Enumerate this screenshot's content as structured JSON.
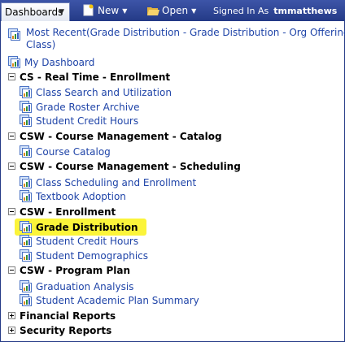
{
  "topbar": {
    "dashboards_tab": "Dashboards",
    "new_menu": "New",
    "open_menu": "Open",
    "signed_in_label": "Signed In As",
    "username": "tmmatthews"
  },
  "recent": {
    "label": "Most Recent(Grade Distribution - Grade Distribution - Org Offering",
    "label_cont": "Class)"
  },
  "my_dashboard": "My Dashboard",
  "groups": [
    {
      "title": "CS - Real Time - Enrollment",
      "items": [
        "Class Search and Utilization",
        "Grade Roster Archive",
        "Student Credit Hours"
      ]
    },
    {
      "title": "CSW - Course Management - Catalog",
      "items": [
        "Course Catalog"
      ]
    },
    {
      "title": "CSW - Course Management - Scheduling",
      "items": [
        "Class Scheduling and Enrollment",
        "Textbook Adoption"
      ]
    },
    {
      "title": "CSW - Enrollment",
      "items": [
        "Grade Distribution",
        "Student Credit Hours",
        "Student Demographics"
      ]
    },
    {
      "title": "CSW - Program Plan",
      "items": [
        "Graduation Analysis",
        "Student Academic Plan Summary"
      ]
    },
    {
      "title": "Financial Reports",
      "items": []
    },
    {
      "title": "Security Reports",
      "items": []
    }
  ],
  "colors": {
    "topbar": "#243a86",
    "link": "#1f44a8",
    "highlight": "#fbf43a"
  }
}
